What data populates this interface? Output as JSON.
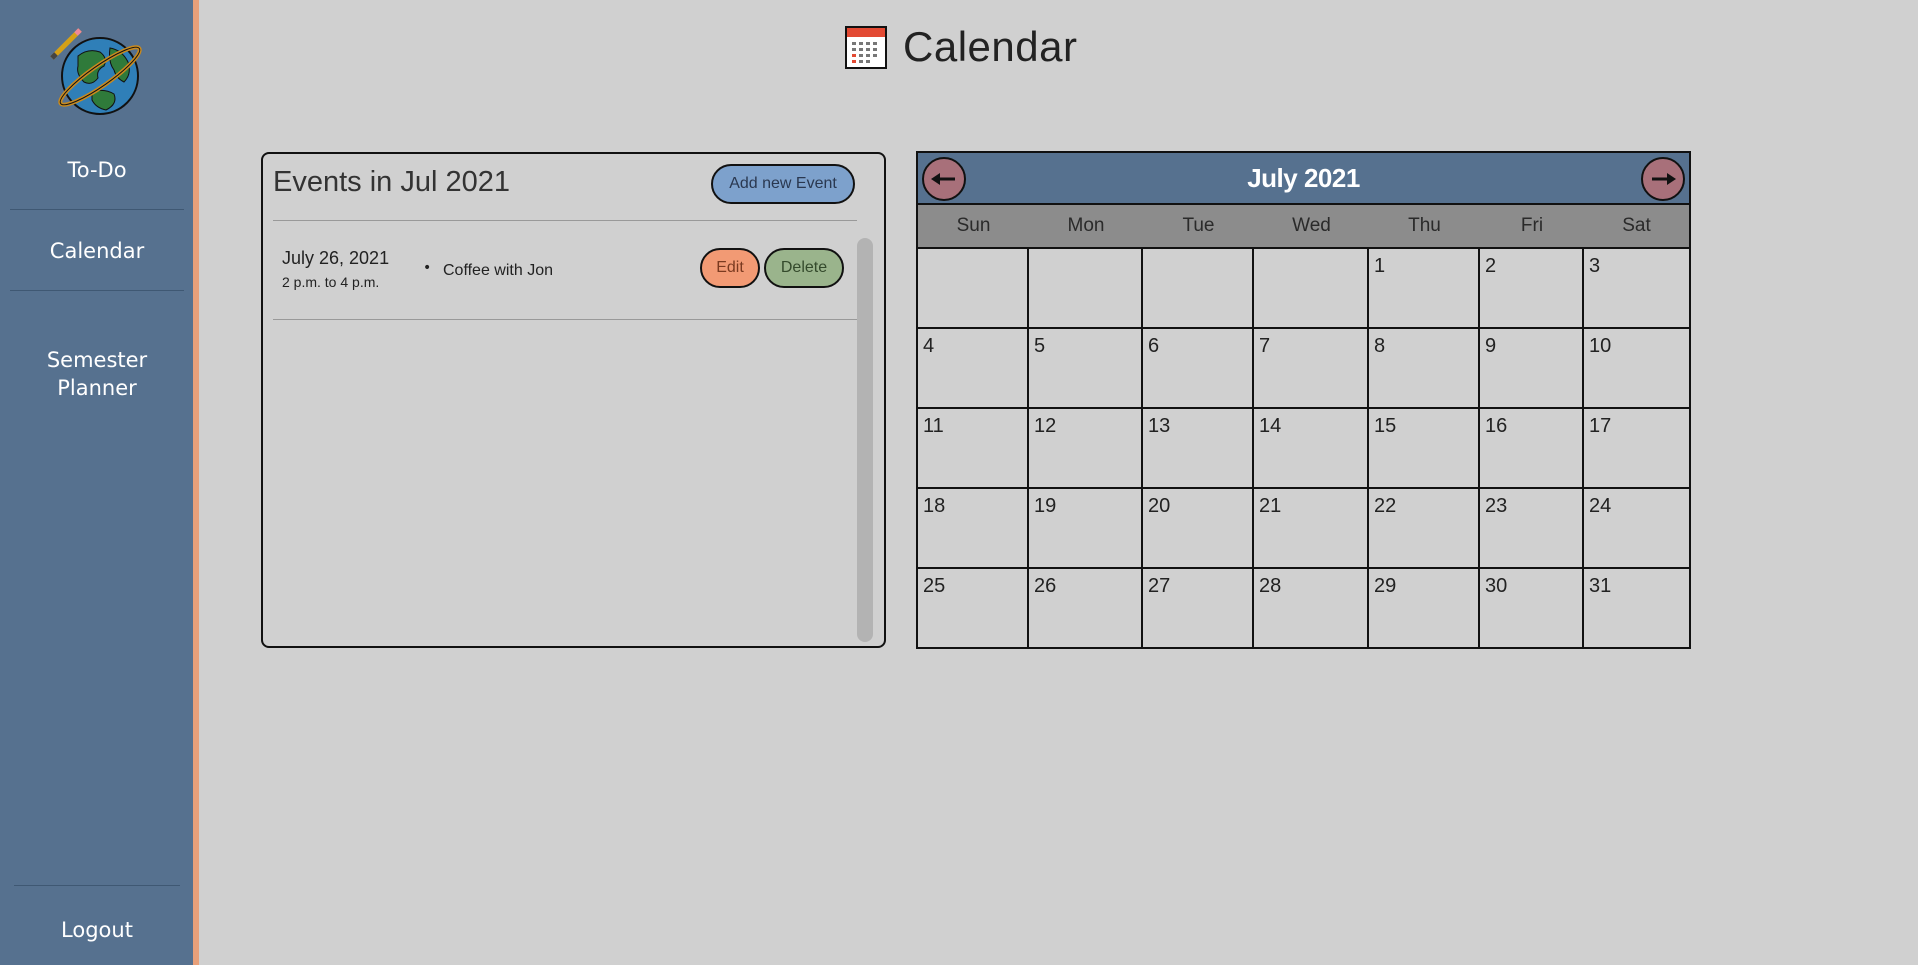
{
  "sidebar": {
    "items": [
      {
        "label": "To-Do"
      },
      {
        "label": "Calendar"
      },
      {
        "label": "Semester\nPlanner"
      }
    ],
    "logout_label": "Logout"
  },
  "page": {
    "title": "Calendar"
  },
  "events": {
    "header": "Events in Jul 2021",
    "add_label": "Add new Event",
    "list": [
      {
        "date": "July 26, 2021",
        "time": "2 p.m. to 4 p.m.",
        "title": "Coffee with Jon",
        "edit_label": "Edit",
        "delete_label": "Delete"
      }
    ]
  },
  "calendar": {
    "month_label": "July 2021",
    "weekdays": [
      "Sun",
      "Mon",
      "Tue",
      "Wed",
      "Thu",
      "Fri",
      "Sat"
    ],
    "weeks": [
      [
        "",
        "",
        "",
        "",
        "1",
        "2",
        "3"
      ],
      [
        "4",
        "5",
        "6",
        "7",
        "8",
        "9",
        "10"
      ],
      [
        "11",
        "12",
        "13",
        "14",
        "15",
        "16",
        "17"
      ],
      [
        "18",
        "19",
        "20",
        "21",
        "22",
        "23",
        "24"
      ],
      [
        "25",
        "26",
        "27",
        "28",
        "29",
        "30",
        "31"
      ]
    ]
  },
  "colors": {
    "sidebar": "#56718f",
    "accent_stripe": "#e8a07a",
    "add_button": "#7da1cc",
    "edit_button": "#f29a74",
    "delete_button": "#9ab48c",
    "nav_arrow": "#a8707a"
  },
  "icons": {
    "logo": "globe-pencil-logo",
    "title": "calendar-icon",
    "prev": "arrow-left-icon",
    "next": "arrow-right-icon"
  }
}
